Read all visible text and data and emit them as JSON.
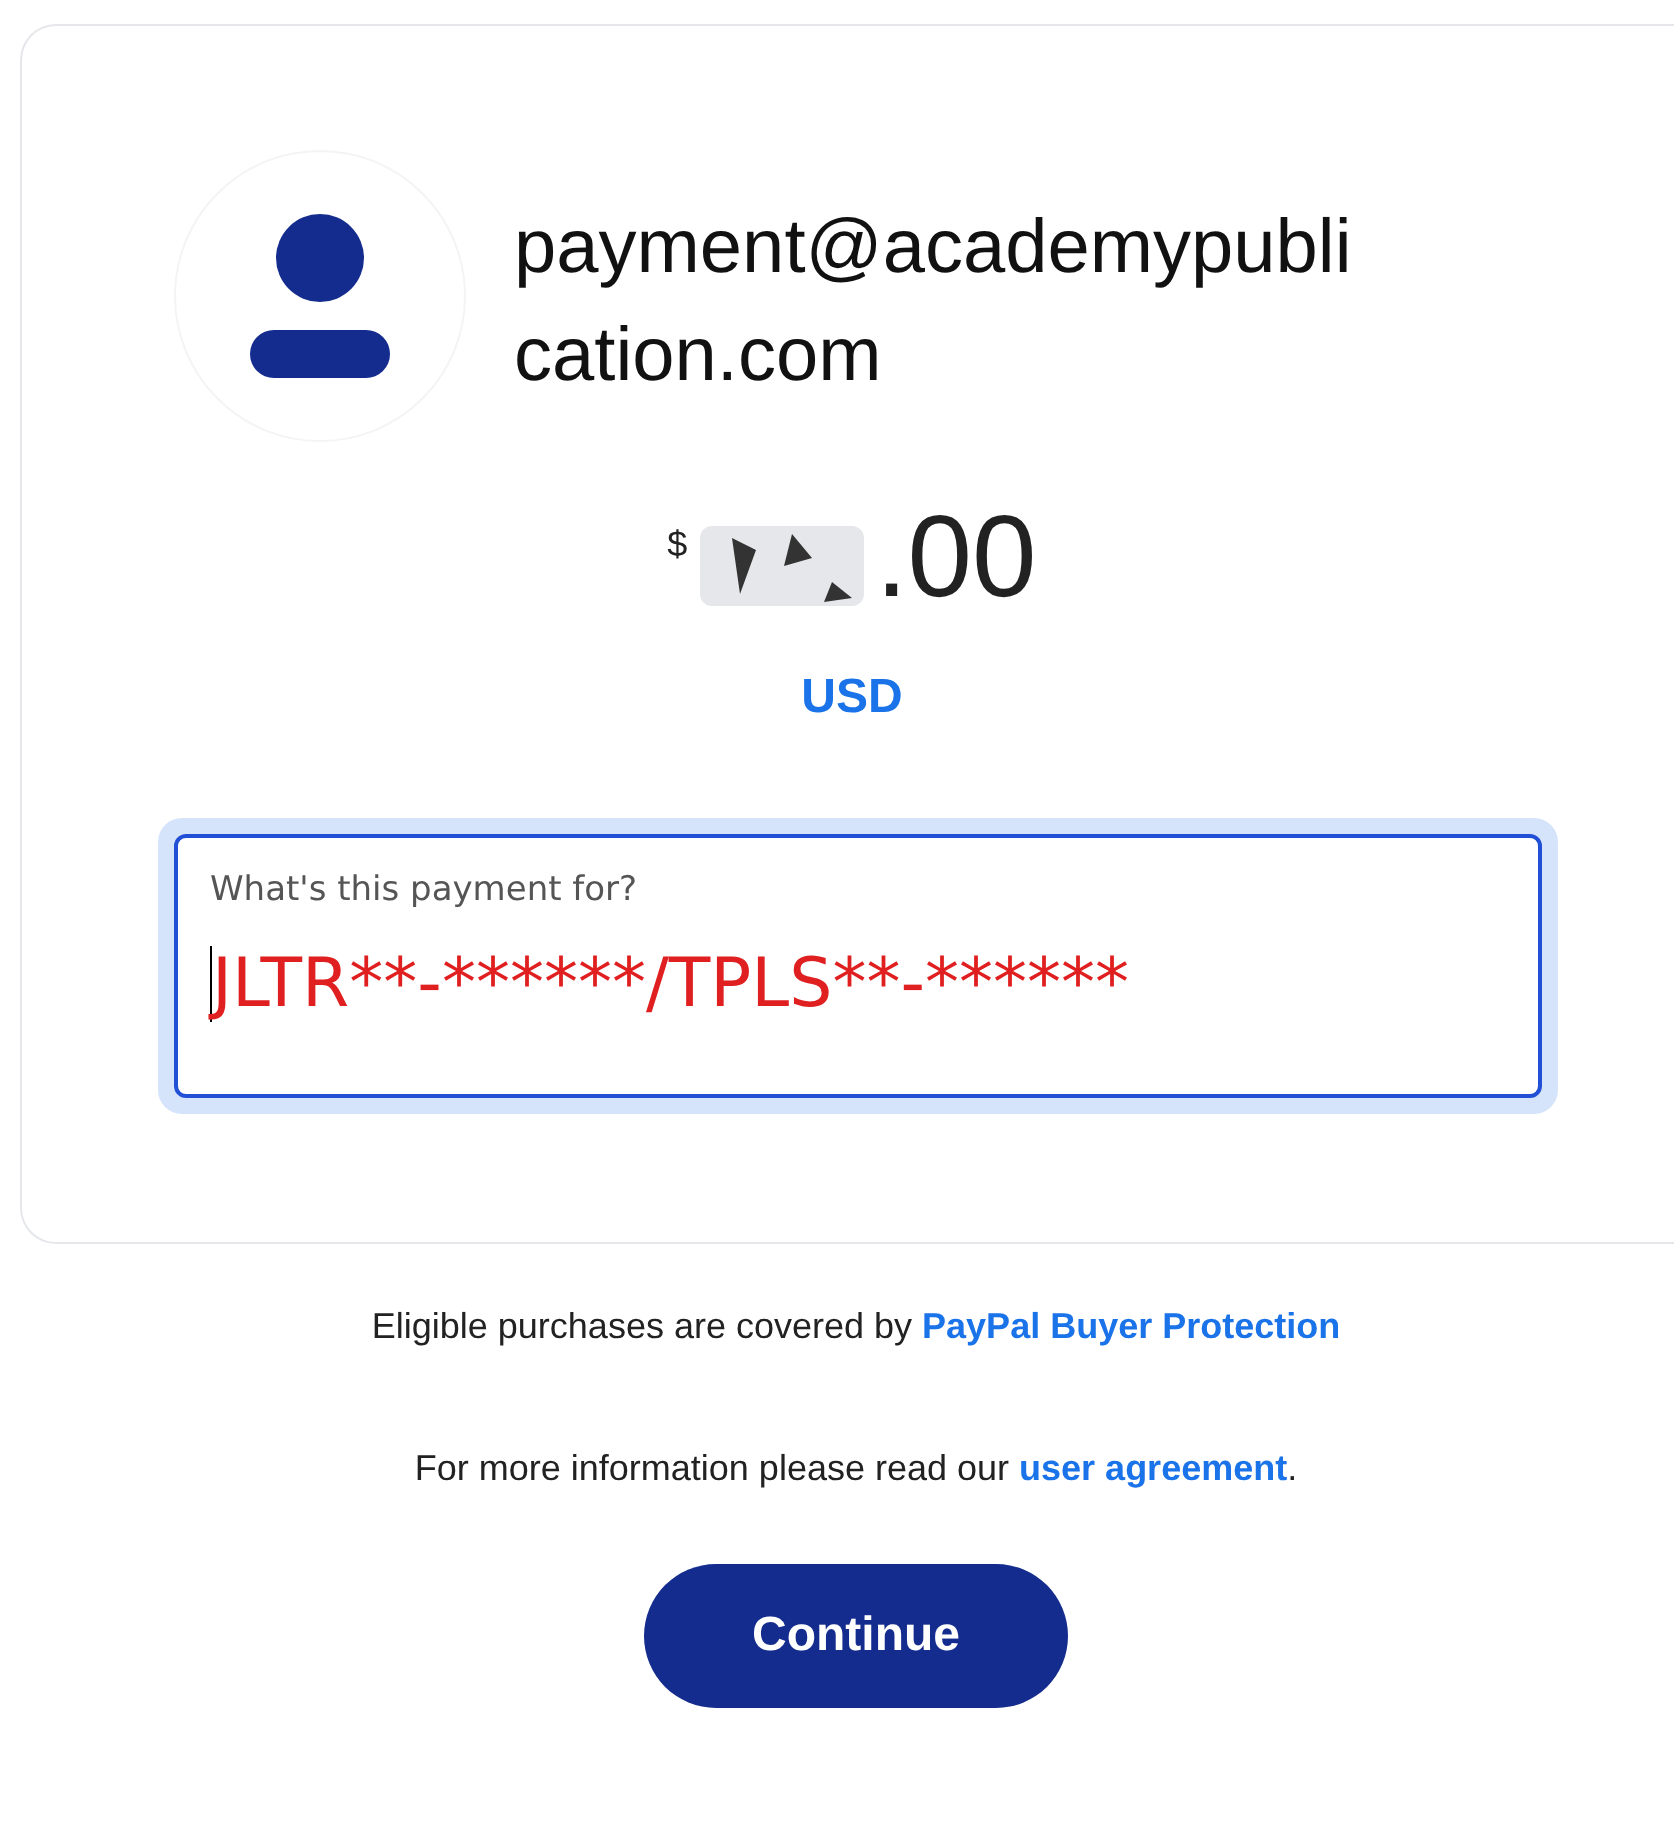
{
  "recipient": {
    "email": "payment@academypublication.com"
  },
  "amount": {
    "currency_symbol": "$",
    "redacted": true,
    "visible_part": ".00",
    "currency": "USD"
  },
  "note_field": {
    "label": "What's this payment for?",
    "value": "JLTR**-******/TPLS**-******",
    "focused": true
  },
  "protection_text": {
    "text": "Eligible purchases are covered by ",
    "link": "PayPal Buyer Protection"
  },
  "agreement_text": {
    "text": "For more information please read our ",
    "link": "user agreement",
    "suffix": "."
  },
  "continue_button": {
    "label": "Continue"
  }
}
